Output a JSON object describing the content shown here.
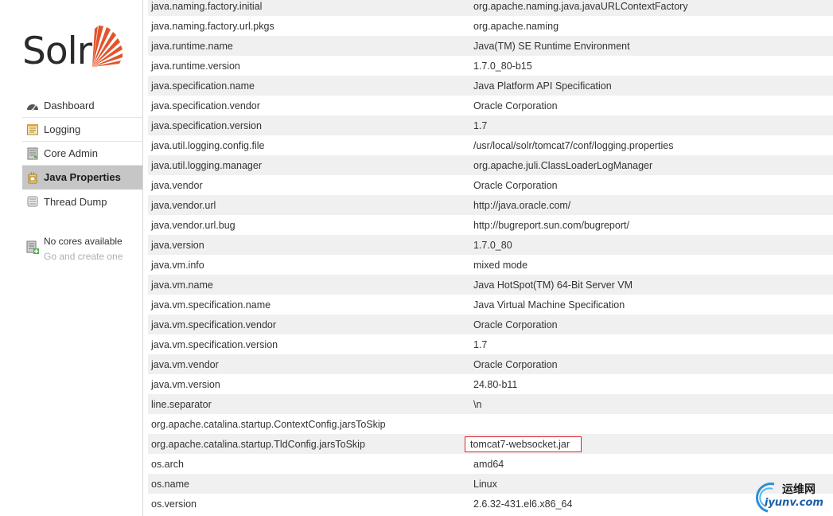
{
  "logo": {
    "text": "Solr"
  },
  "nav": {
    "items": [
      {
        "label": "Dashboard",
        "icon": "dashboard-icon"
      },
      {
        "label": "Logging",
        "icon": "logging-icon"
      },
      {
        "label": "Core Admin",
        "icon": "core-admin-icon"
      },
      {
        "label": "Java Properties",
        "icon": "java-icon",
        "active": true
      },
      {
        "label": "Thread Dump",
        "icon": "thread-dump-icon"
      }
    ]
  },
  "cores": {
    "title": "No cores available",
    "hint": "Go and create one"
  },
  "properties": [
    {
      "key": "java.naming.factory.initial",
      "value": "org.apache.naming.java.javaURLContextFactory"
    },
    {
      "key": "java.naming.factory.url.pkgs",
      "value": "org.apache.naming"
    },
    {
      "key": "java.runtime.name",
      "value": "Java(TM) SE Runtime Environment"
    },
    {
      "key": "java.runtime.version",
      "value": "1.7.0_80-b15"
    },
    {
      "key": "java.specification.name",
      "value": "Java Platform API Specification"
    },
    {
      "key": "java.specification.vendor",
      "value": "Oracle Corporation"
    },
    {
      "key": "java.specification.version",
      "value": "1.7"
    },
    {
      "key": "java.util.logging.config.file",
      "value": "/usr/local/solr/tomcat7/conf/logging.properties"
    },
    {
      "key": "java.util.logging.manager",
      "value": "org.apache.juli.ClassLoaderLogManager"
    },
    {
      "key": "java.vendor",
      "value": "Oracle Corporation"
    },
    {
      "key": "java.vendor.url",
      "value": "http://java.oracle.com/"
    },
    {
      "key": "java.vendor.url.bug",
      "value": "http://bugreport.sun.com/bugreport/"
    },
    {
      "key": "java.version",
      "value": "1.7.0_80"
    },
    {
      "key": "java.vm.info",
      "value": "mixed mode"
    },
    {
      "key": "java.vm.name",
      "value": "Java HotSpot(TM) 64-Bit Server VM"
    },
    {
      "key": "java.vm.specification.name",
      "value": "Java Virtual Machine Specification"
    },
    {
      "key": "java.vm.specification.vendor",
      "value": "Oracle Corporation"
    },
    {
      "key": "java.vm.specification.version",
      "value": "1.7"
    },
    {
      "key": "java.vm.vendor",
      "value": "Oracle Corporation"
    },
    {
      "key": "java.vm.version",
      "value": "24.80-b11"
    },
    {
      "key": "line.separator",
      "value": "\\n"
    },
    {
      "key": "org.apache.catalina.startup.ContextConfig.jarsToSkip",
      "value": ""
    },
    {
      "key": "org.apache.catalina.startup.TldConfig.jarsToSkip",
      "value": "tomcat7-websocket.jar",
      "highlight": true
    },
    {
      "key": "os.arch",
      "value": "amd64"
    },
    {
      "key": "os.name",
      "value": "Linux"
    },
    {
      "key": "os.version",
      "value": "2.6.32-431.el6.x86_64"
    }
  ],
  "watermark": {
    "cn": "运维网",
    "en": "iyunv.com"
  },
  "colors": {
    "accent": "#e2542c",
    "active_bg": "#c6c6c6",
    "stripe": "#f0f0f0",
    "highlight_border": "#d9262e"
  }
}
